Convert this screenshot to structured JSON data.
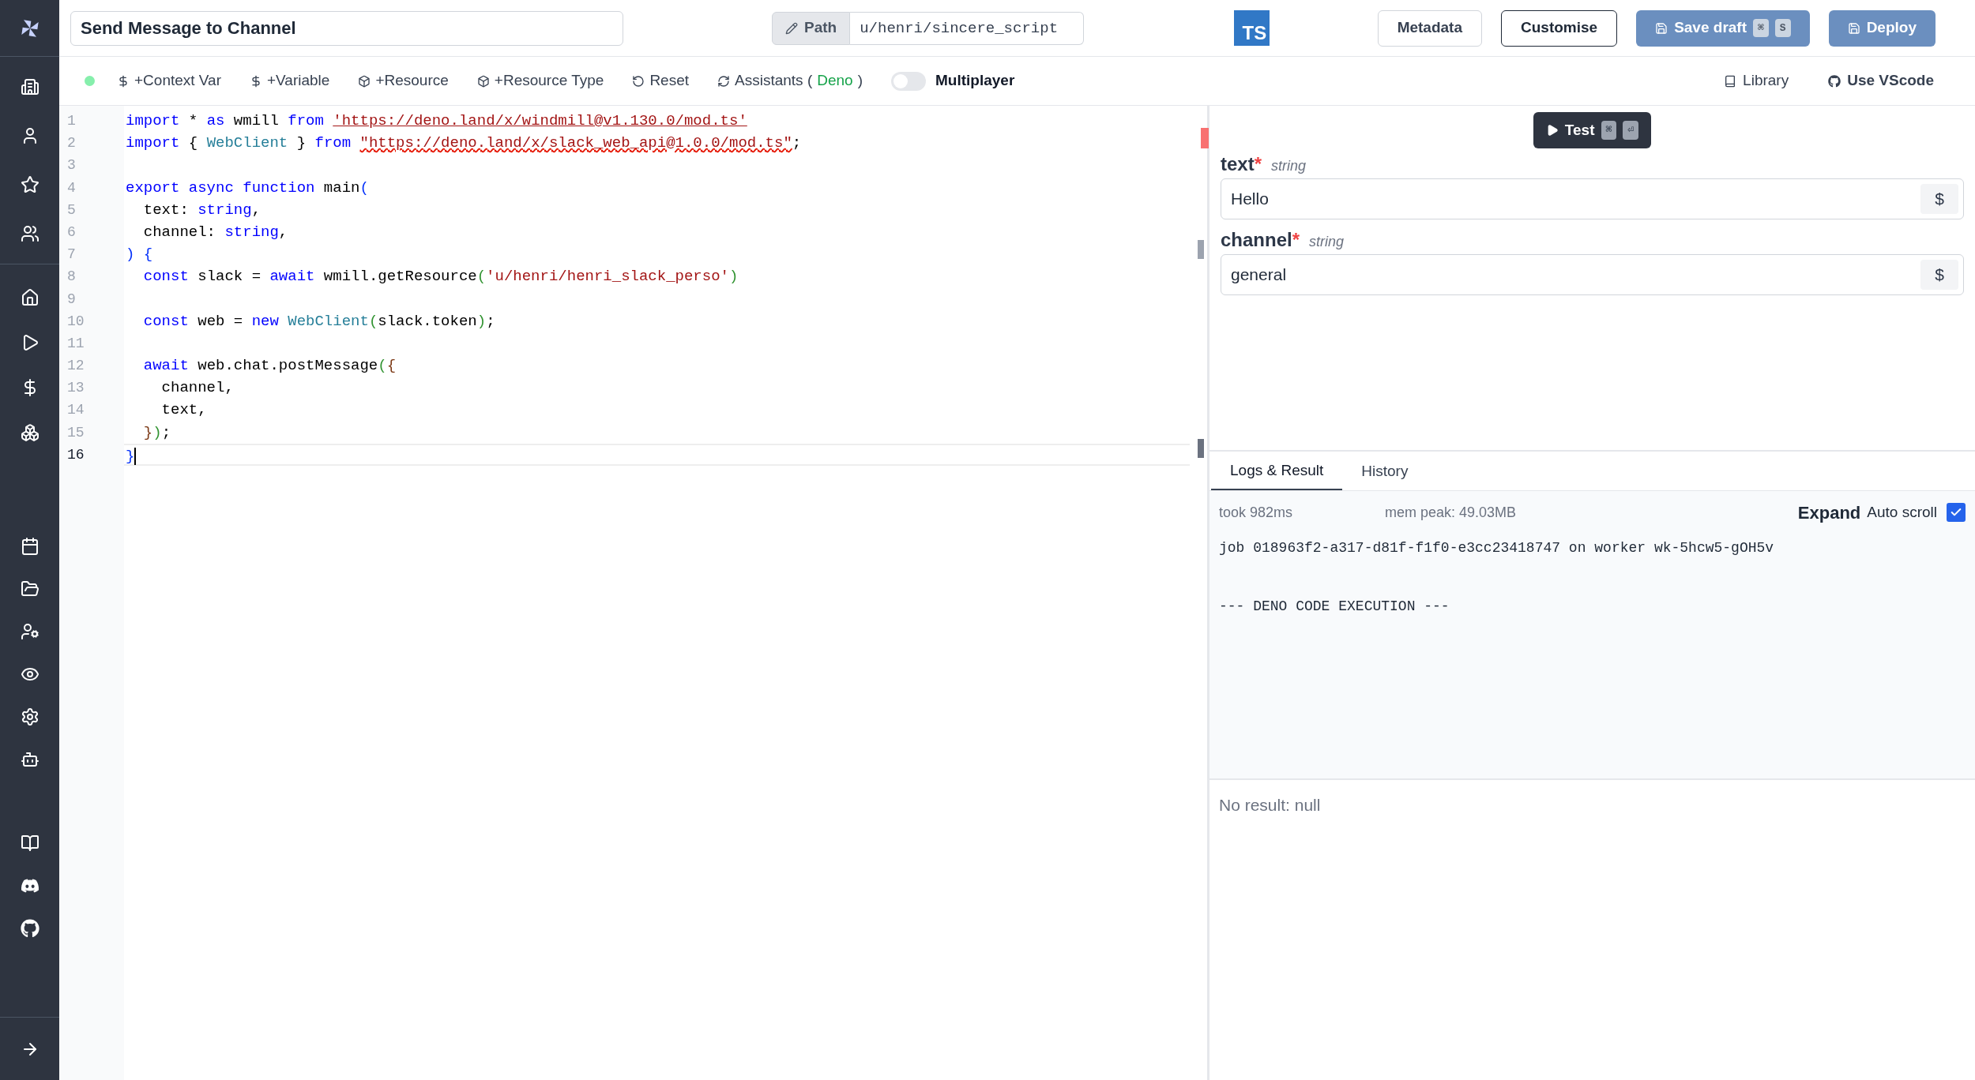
{
  "header": {
    "title": "Send Message to Channel",
    "path_label": "Path",
    "path": "u/henri/sincere_script",
    "language_badge": "TS",
    "buttons": [
      {
        "label": "Metadata",
        "kind": "outline"
      },
      {
        "label": "Customise",
        "kind": "dark-outline"
      },
      {
        "label": "Save draft",
        "kind": "primary",
        "keys": [
          "⌘",
          "S"
        ]
      },
      {
        "label": "Deploy",
        "kind": "primary"
      }
    ]
  },
  "toolbar": {
    "items": [
      "+Context Var",
      "+Variable",
      "+Resource",
      "+Resource Type",
      "Reset"
    ],
    "assistants": [
      "Assistants (",
      "Deno",
      ")"
    ],
    "multiplayer": {
      "label": "Multiplayer",
      "on": false
    },
    "right": [
      "Library",
      "Use VScode"
    ]
  },
  "editor": {
    "lines": [
      {
        "n": "1",
        "current": false,
        "tokens": [
          {
            "text": "import",
            "kind": "kw"
          },
          {
            "text": " * ",
            "kind": "plain"
          },
          {
            "text": "as",
            "kind": "kw"
          },
          {
            "text": " wmill ",
            "kind": "plain"
          },
          {
            "text": "from ",
            "kind": "kw"
          },
          {
            "text": "'https://deno.land/x/windmill@v1.130.0/mod.ts'",
            "kind": "link"
          }
        ]
      },
      {
        "n": "2",
        "current": false,
        "tokens": [
          {
            "text": "import",
            "kind": "kw"
          },
          {
            "text": " { ",
            "kind": "plain"
          },
          {
            "text": "WebClient",
            "kind": "type"
          },
          {
            "text": " } ",
            "kind": "plain"
          },
          {
            "text": "from ",
            "kind": "kw"
          },
          {
            "text": "\"https://deno.land/x/slack_web_api@1.0.0/mod.ts\"",
            "kind": "err"
          },
          {
            "text": ";",
            "kind": "plain"
          }
        ]
      },
      {
        "n": "3",
        "current": false
      },
      {
        "n": "4",
        "current": false,
        "tokens": [
          {
            "text": "export async function",
            "kind": "kw"
          },
          {
            "text": " main",
            "kind": "plain"
          },
          {
            "text": "(",
            "kind": "b1"
          }
        ]
      },
      {
        "n": "5",
        "current": false,
        "tokens": [
          {
            "text": "  text: ",
            "kind": "plain"
          },
          {
            "text": "string",
            "kind": "kw"
          },
          {
            "text": ",",
            "kind": "plain"
          }
        ]
      },
      {
        "n": "6",
        "current": false,
        "tokens": [
          {
            "text": "  channel: ",
            "kind": "plain"
          },
          {
            "text": "string",
            "kind": "kw"
          },
          {
            "text": ",",
            "kind": "plain"
          }
        ]
      },
      {
        "n": "7",
        "current": false,
        "tokens": [
          {
            "text": ") ",
            "kind": "b1"
          },
          {
            "text": "{",
            "kind": "b1"
          }
        ]
      },
      {
        "n": "8",
        "current": false,
        "tokens": [
          {
            "text": "  const",
            "kind": "kw"
          },
          {
            "text": " slack = ",
            "kind": "plain"
          },
          {
            "text": "await",
            "kind": "kw"
          },
          {
            "text": " wmill.getResource",
            "kind": "plain"
          },
          {
            "text": "(",
            "kind": "b2"
          },
          {
            "text": "'u/henri/henri_slack_perso'",
            "kind": "str"
          },
          {
            "text": ")",
            "kind": "b2"
          }
        ]
      },
      {
        "n": "9",
        "current": false
      },
      {
        "n": "10",
        "current": false,
        "tokens": [
          {
            "text": "  const",
            "kind": "kw"
          },
          {
            "text": " web = ",
            "kind": "plain"
          },
          {
            "text": "new ",
            "kind": "kw"
          },
          {
            "text": "WebClient",
            "kind": "type"
          },
          {
            "text": "(",
            "kind": "b2"
          },
          {
            "text": "slack.token",
            "kind": "plain"
          },
          {
            "text": ")",
            "kind": "b2"
          },
          {
            "text": ";",
            "kind": "plain"
          }
        ]
      },
      {
        "n": "11",
        "current": false
      },
      {
        "n": "12",
        "current": false,
        "tokens": [
          {
            "text": "  await",
            "kind": "kw"
          },
          {
            "text": " web.chat.postMessage",
            "kind": "plain"
          },
          {
            "text": "(",
            "kind": "b2"
          },
          {
            "text": "{",
            "kind": "b3"
          }
        ]
      },
      {
        "n": "13",
        "current": false,
        "tokens": [
          {
            "text": "    channel,",
            "kind": "plain"
          }
        ]
      },
      {
        "n": "14",
        "current": false,
        "tokens": [
          {
            "text": "    text,",
            "kind": "plain"
          }
        ]
      },
      {
        "n": "15",
        "current": false,
        "tokens": [
          {
            "text": "  }",
            "kind": "b3"
          },
          {
            "text": ")",
            "kind": "b2"
          },
          {
            "text": ";",
            "kind": "plain"
          }
        ]
      },
      {
        "n": "16",
        "current": true,
        "tokens": [
          {
            "text": "}",
            "kind": "b1"
          }
        ]
      }
    ]
  },
  "test": {
    "button": "Test",
    "keys": [
      "⌘",
      "⏎"
    ],
    "fields": [
      {
        "name": "text",
        "type": "string",
        "value": "Hello",
        "button": "$"
      },
      {
        "name": "channel",
        "type": "string",
        "value": "general",
        "button": "$"
      }
    ]
  },
  "logs": {
    "tabs": [
      {
        "label": "Logs & Result",
        "selected": true
      },
      {
        "label": "History",
        "selected": false
      }
    ],
    "took": "took 982ms",
    "mem": "mem peak: 49.03MB",
    "expand": "Expand",
    "auto_scroll": {
      "label": "Auto scroll",
      "checked": true
    },
    "lines": [
      "job 018963f2-a317-d81f-f1f0-e3cc23418747 on worker wk-5hcw5-gOH5v",
      "--- DENO CODE EXECUTION ---"
    ],
    "result": "No result: null"
  }
}
